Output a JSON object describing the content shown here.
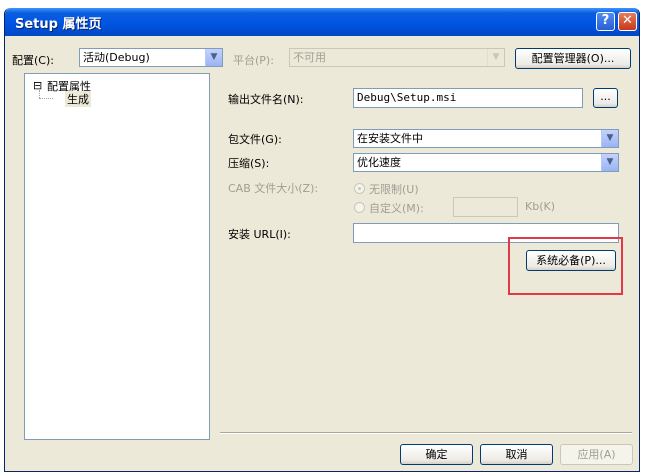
{
  "window": {
    "title": "Setup 属性页",
    "help_label": "?",
    "close_label": "✕"
  },
  "config": {
    "config_label": "配置(C):",
    "config_value": "活动(Debug)",
    "platform_label": "平台(P):",
    "platform_value": "不可用",
    "manager_button": "配置管理器(O)..."
  },
  "tree": {
    "root_label": "配置属性",
    "root_toggle": "⊟",
    "child_label": "生成"
  },
  "form": {
    "output_label": "输出文件名(N):",
    "output_value": "Debug\\Setup.msi",
    "browse_button": "...",
    "package_label": "包文件(G):",
    "package_value": "在安装文件中",
    "compress_label": "压缩(S):",
    "compress_value": "优化速度",
    "cab_label": "CAB 文件大小(Z):",
    "unlimited_label": "无限制(U)",
    "custom_label": "自定义(M):",
    "kb_label": "Kb(K)",
    "url_label": "安装 URL(I):",
    "url_value": "",
    "prereq_button": "系统必备(P)..."
  },
  "footer": {
    "ok_button": "确定",
    "cancel_button": "取消",
    "apply_button": "应用(A)"
  },
  "colors": {
    "highlight": "#e03a4a",
    "titlebar": "#0054e3",
    "dialog_bg": "#ece9d8"
  }
}
